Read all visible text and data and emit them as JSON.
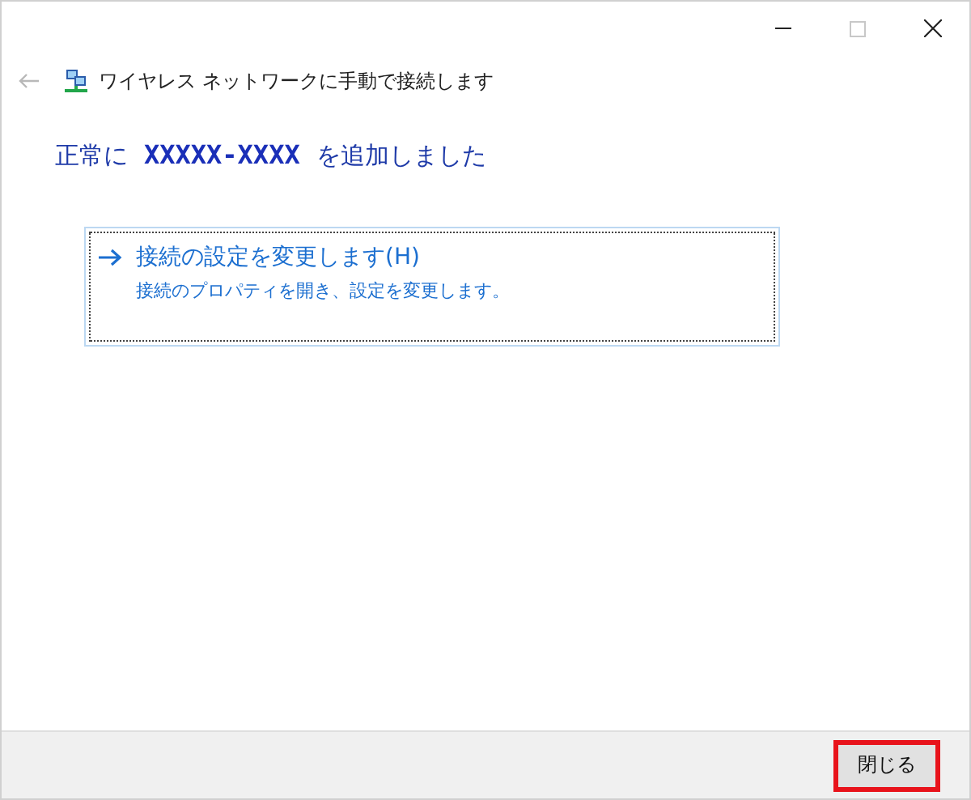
{
  "window": {
    "controls": [
      {
        "kind": "minimize",
        "disabled": false
      },
      {
        "kind": "maximize",
        "disabled": true
      },
      {
        "kind": "close",
        "disabled": false
      }
    ]
  },
  "header": {
    "back_disabled": true,
    "title": "ワイヤレス ネットワークに手動で接続します"
  },
  "heading": {
    "prefix": "正常に",
    "network_name": "XXXXX-XXXX",
    "suffix": "を追加しました"
  },
  "option": {
    "title": "接続の設定を変更します(H)",
    "description": "接続のプロパティを開き、設定を変更します。",
    "focused": true
  },
  "buttons": [
    {
      "label": "閉じる",
      "highlighted": true
    }
  ]
}
